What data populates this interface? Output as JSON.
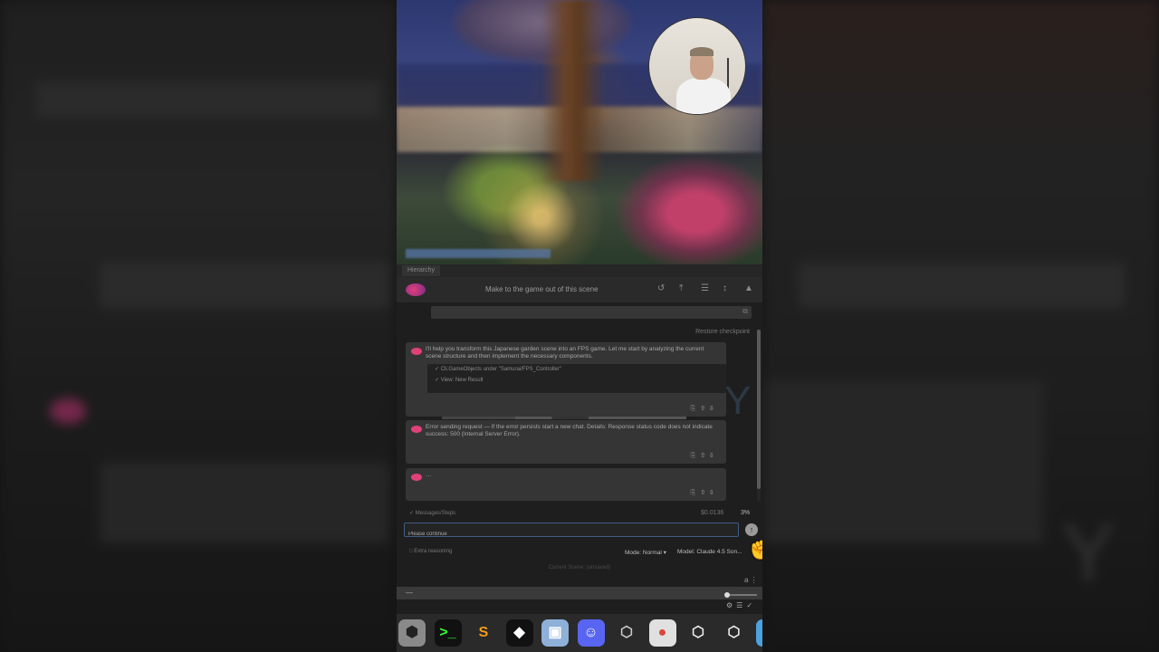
{
  "header": {
    "title": "Make to the game out of this scene",
    "actions": [
      "↺",
      "⤒",
      "☰",
      "↕",
      "▲"
    ]
  },
  "tab": {
    "label": "Hierarchy"
  },
  "search": {
    "placeholder": "",
    "copy_icon": "copy-icon"
  },
  "restore_label": "Restore checkpoint",
  "messages": [
    {
      "text": "I'll help you transform this Japanese garden scene into an FPS game. Let me start by analyzing the current scene structure and then implement the necessary components.",
      "code_lines": [
        "✓ Cli.GameObjects under \"Samurai/FPS_Controller\"",
        "✓ View: New Result"
      ],
      "actions": [
        "⎘",
        "⇧",
        "⇩"
      ]
    },
    {
      "text": "Error sending request — If the error persists start a new chat. Details: Response status code does not indicate success: 500 (Internal Server Error).",
      "actions": [
        "⎘",
        "⇧",
        "⇩"
      ]
    },
    {
      "text": "…",
      "actions": [
        "⎘",
        "⇧",
        "⇩"
      ]
    }
  ],
  "usage": {
    "label": "✓ Messages/Steps",
    "cost": "$0.0136",
    "percent": "3%"
  },
  "input": {
    "value": "Please continue"
  },
  "thinking": {
    "label": "□ Extra reasoning"
  },
  "mode": {
    "label": "Mode: Normal ▾"
  },
  "model": {
    "label": "Model: Claude 4.5 Son..."
  },
  "footer": {
    "text": "Current Scene: (unsaved)"
  },
  "statusbar": {
    "left": "—"
  },
  "dock": {
    "apps": [
      {
        "name": "unity-hub-icon",
        "glyph": "⬢",
        "bg": "#8a8a8a",
        "fg": "#222"
      },
      {
        "name": "terminal-icon",
        "glyph": ">_",
        "bg": "#111",
        "fg": "#3f3"
      },
      {
        "name": "sublime-icon",
        "glyph": "S",
        "bg": "#2a2a2a",
        "fg": "#f39c12"
      },
      {
        "name": "unity-icon",
        "glyph": "◆",
        "bg": "#111",
        "fg": "#fff"
      },
      {
        "name": "preview-icon",
        "glyph": "▣",
        "bg": "#8fb0d8",
        "fg": "#fff"
      },
      {
        "name": "discord-icon",
        "glyph": "☺",
        "bg": "#5865f2",
        "fg": "#fff"
      },
      {
        "name": "unity-6-icon",
        "glyph": "⬡",
        "bg": "#2a2a2a",
        "fg": "#ccc"
      },
      {
        "name": "chrome-icon",
        "glyph": "●",
        "bg": "#e0e0e0",
        "fg": "#db4437"
      },
      {
        "name": "unity-alt-icon",
        "glyph": "⬡",
        "bg": "#2a2a2a",
        "fg": "#eee"
      },
      {
        "name": "unity-alt2-icon",
        "glyph": "⬡",
        "bg": "#2a2a2a",
        "fg": "#eee"
      },
      {
        "name": "finder-icon",
        "glyph": "◐",
        "bg": "#4aa3e0",
        "fg": "#fff"
      }
    ]
  },
  "colors": {
    "accent": "#e0407a",
    "input_border": "#3f5e84",
    "panel": "#2a2a2a"
  }
}
